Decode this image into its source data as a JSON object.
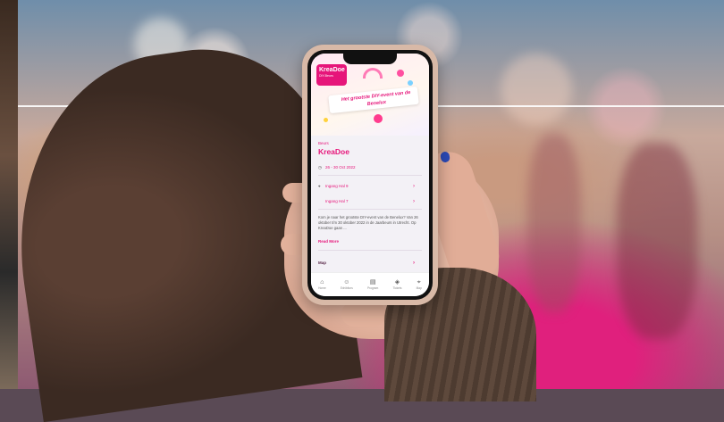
{
  "app": {
    "logo_text": "KreaDoe",
    "logo_sub": "DIY-Beurs",
    "banner": "Het grootste DIY-event van de Benelux",
    "section_label": "Beurs",
    "event_title": "KreaDoe",
    "date": "26 - 30 Oct 2022",
    "entrances": [
      "Ingang Hal 9",
      "Ingang Hal 7"
    ],
    "description": "Kom je naar het grootste DIY-event van de Benelux? Van 26 oktober t/m 30 oktober 2022 in de Jaarbeurs in Utrecht. Op KreaDoe gaan ...",
    "read_more": "Read More",
    "map_label": "Map",
    "tabs": [
      "Home",
      "Exhibitors",
      "Program",
      "Tickets",
      "Map"
    ],
    "accent": "#e6157a"
  }
}
